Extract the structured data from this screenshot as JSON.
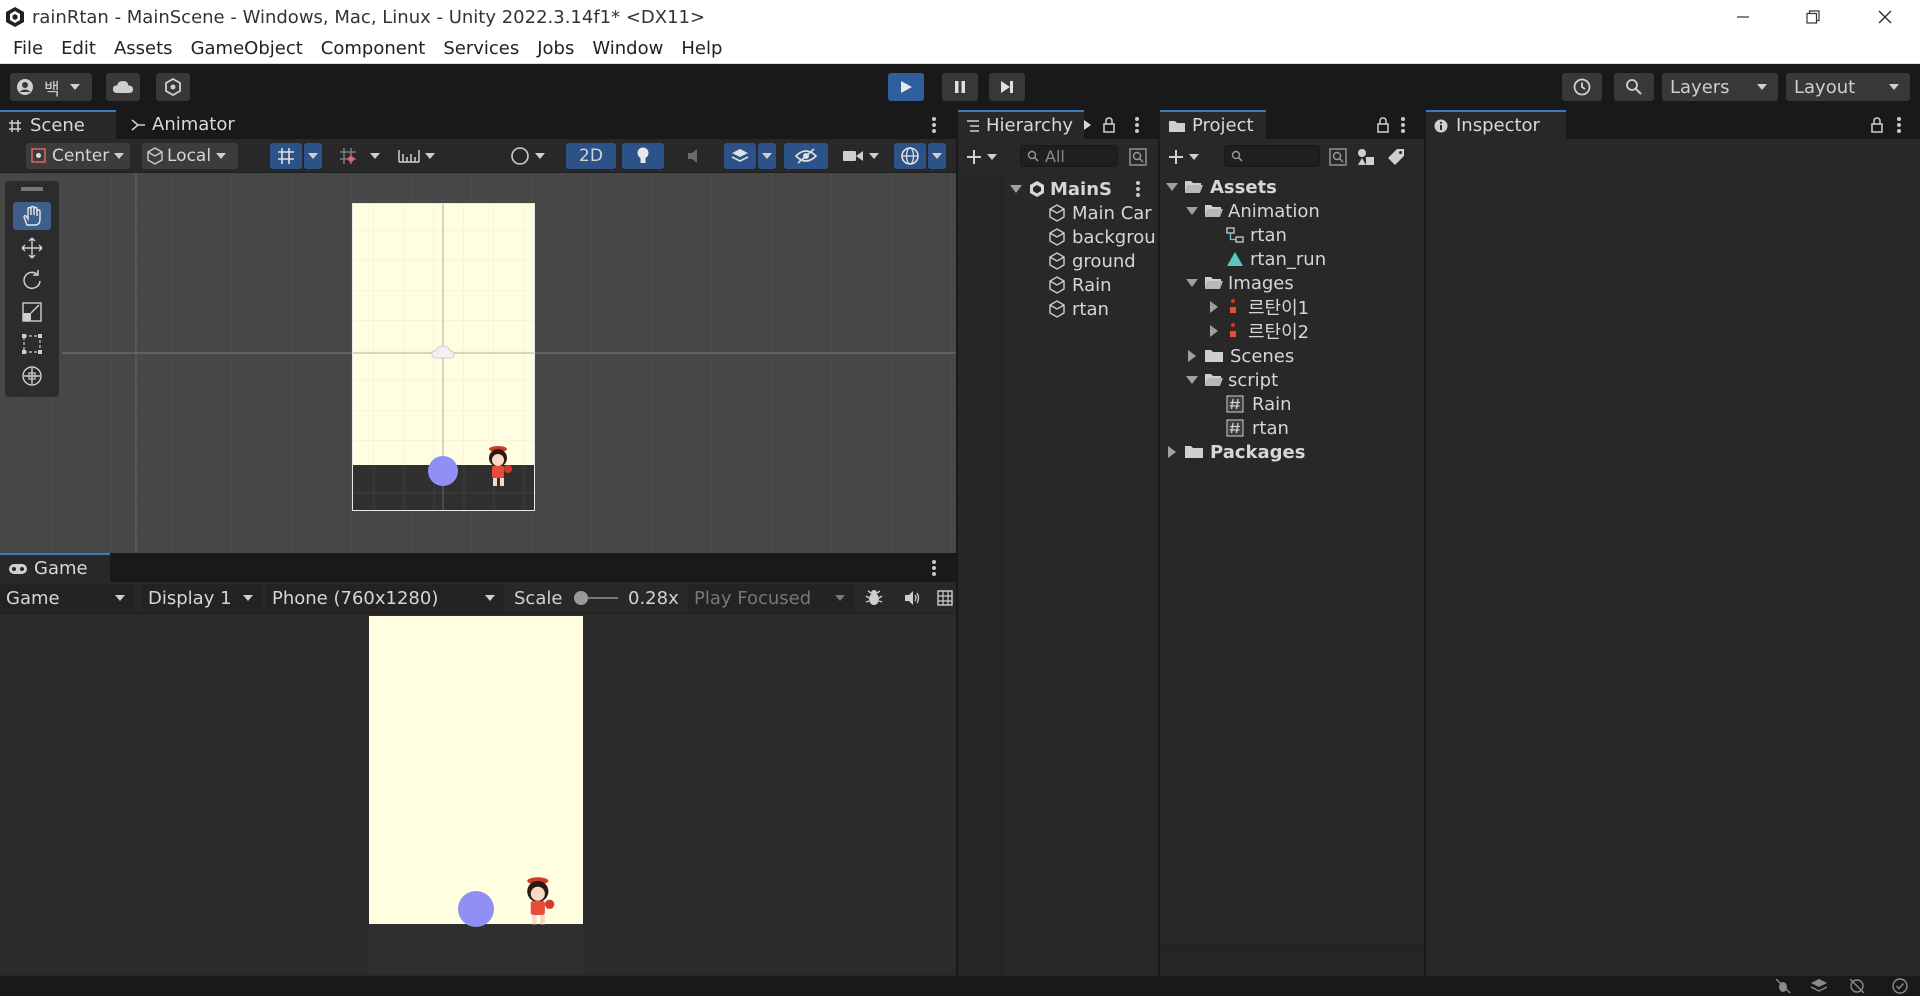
{
  "window": {
    "title": "rainRtan - MainScene - Windows, Mac, Linux - Unity 2022.3.14f1* <DX11>"
  },
  "menu": [
    "File",
    "Edit",
    "Assets",
    "GameObject",
    "Component",
    "Services",
    "Jobs",
    "Window",
    "Help"
  ],
  "toolbar": {
    "account_label": "백",
    "layers_label": "Layers",
    "layout_label": "Layout"
  },
  "scene_panel": {
    "tabs": [
      "Scene",
      "Animator"
    ],
    "pivot_label": "Center",
    "space_label": "Local",
    "mode_2d_label": "2D"
  },
  "game_panel": {
    "tab": "Game",
    "view_select": "Game",
    "display_select": "Display 1",
    "resolution_select": "Phone (760x1280)",
    "scale_label": "Scale",
    "scale_value": "0.28x",
    "play_mode": "Play Focused"
  },
  "hierarchy": {
    "tab": "Hierarchy",
    "search_placeholder": "All",
    "scene_name": "MainSc",
    "items": [
      "Main Car",
      "backgrou",
      "ground",
      "Rain",
      "rtan"
    ]
  },
  "project": {
    "tab": "Project",
    "tree": {
      "assets": "Assets",
      "animation": "Animation",
      "anim_rtan": "rtan",
      "anim_rtan_run": "rtan_run",
      "images": "Images",
      "img1": "르탄이1",
      "img2": "르탄이2",
      "scenes": "Scenes",
      "script": "script",
      "script_rain": "Rain",
      "script_rtan": "rtan",
      "packages": "Packages"
    }
  },
  "inspector": {
    "tab": "Inspector"
  },
  "colors": {
    "accent": "#3a79bb",
    "play_button": "#2e5e9c",
    "game_bg": "#fffee0",
    "rain_drop": "#8f8ff5",
    "ground": "#2f2f2f"
  }
}
